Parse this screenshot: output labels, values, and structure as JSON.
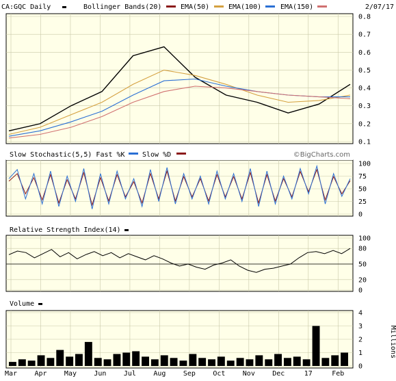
{
  "header": {
    "symbol_label": "CA:GQC Daily",
    "date": "2/07/17",
    "legend": [
      {
        "label": "Bollinger Bands(20)",
        "color": "#8b1a1a"
      },
      {
        "label": "EMA(50)",
        "color": "#d4a040"
      },
      {
        "label": "EMA(100)",
        "color": "#2a6fd4"
      },
      {
        "label": "EMA(150)",
        "color": "#d07070"
      }
    ]
  },
  "watermark": "©BigCharts.com",
  "panels": {
    "stochastic": {
      "title": "Slow Stochastic(5,5) Fast %K",
      "legend": [
        {
          "label": "Slow %D",
          "color": "#8b1a1a"
        }
      ],
      "k_color": "#2a6fd4"
    },
    "rsi": {
      "title": "Relative Strength Index(14)"
    },
    "volume": {
      "title": "Volume",
      "units_label": "Millions"
    }
  },
  "axes": {
    "price_ticks": [
      "0.8",
      "0.7",
      "0.6",
      "0.5",
      "0.4",
      "0.3",
      "0.2",
      "0.1"
    ],
    "stoch_ticks": [
      "100",
      "75",
      "50",
      "25",
      "0"
    ],
    "rsi_ticks": [
      "100",
      "80",
      "50",
      "20",
      "0"
    ],
    "volume_ticks": [
      "4",
      "3",
      "2",
      "1",
      "0"
    ],
    "months": [
      "Mar",
      "Apr",
      "May",
      "Jun",
      "Jul",
      "Aug",
      "Sep",
      "Oct",
      "Nov",
      "Dec",
      "17",
      "Feb"
    ]
  },
  "chart_data": [
    {
      "type": "line",
      "panel": "price",
      "ylim": [
        0.1,
        0.8
      ],
      "x": [
        "Mar",
        "Apr",
        "May",
        "Jun",
        "Jul",
        "Aug",
        "Sep",
        "Oct",
        "Nov",
        "Dec",
        "17",
        "Feb"
      ],
      "series": [
        {
          "name": "CA:GQC Daily",
          "values": [
            0.16,
            0.2,
            0.3,
            0.38,
            0.58,
            0.63,
            0.46,
            0.36,
            0.32,
            0.26,
            0.31,
            0.42
          ]
        },
        {
          "name": "EMA(50)",
          "values": [
            0.14,
            0.18,
            0.25,
            0.32,
            0.42,
            0.5,
            0.47,
            0.42,
            0.36,
            0.32,
            0.33,
            0.36
          ]
        },
        {
          "name": "EMA(100)",
          "values": [
            0.13,
            0.16,
            0.21,
            0.27,
            0.36,
            0.44,
            0.45,
            0.41,
            0.38,
            0.36,
            0.35,
            0.35
          ]
        },
        {
          "name": "EMA(150)",
          "values": [
            0.12,
            0.14,
            0.18,
            0.24,
            0.32,
            0.38,
            0.41,
            0.4,
            0.38,
            0.36,
            0.35,
            0.34
          ]
        }
      ]
    },
    {
      "type": "line",
      "panel": "stochastic",
      "ylim": [
        0,
        100
      ],
      "series": [
        {
          "name": "Fast %K",
          "values": [
            70,
            88,
            30,
            80,
            20,
            85,
            15,
            75,
            25,
            90,
            10,
            80,
            20,
            85,
            30,
            70,
            15,
            88,
            25,
            92,
            20,
            80,
            30,
            75,
            20,
            85,
            30,
            80,
            25,
            90,
            15,
            85,
            20,
            75,
            30,
            90,
            40,
            95,
            20,
            80,
            35,
            70
          ]
        },
        {
          "name": "Slow %D",
          "values": [
            65,
            80,
            40,
            72,
            28,
            78,
            22,
            68,
            30,
            82,
            18,
            72,
            26,
            78,
            34,
            64,
            22,
            80,
            30,
            85,
            26,
            74,
            34,
            70,
            26,
            78,
            34,
            74,
            30,
            82,
            22,
            78,
            26,
            70,
            34,
            84,
            44,
            88,
            28,
            74,
            40,
            66
          ]
        }
      ]
    },
    {
      "type": "line",
      "panel": "rsi",
      "ylim": [
        0,
        100
      ],
      "series": [
        {
          "name": "RSI(14)",
          "values": [
            68,
            75,
            72,
            62,
            70,
            78,
            64,
            72,
            60,
            68,
            74,
            66,
            72,
            62,
            70,
            64,
            58,
            66,
            60,
            52,
            46,
            50,
            44,
            40,
            48,
            52,
            58,
            46,
            38,
            34,
            40,
            42,
            46,
            50,
            62,
            72,
            74,
            70,
            76,
            70,
            80
          ]
        }
      ]
    },
    {
      "type": "bar",
      "panel": "volume",
      "ylim": [
        0,
        4
      ],
      "series": [
        {
          "name": "Volume",
          "values": [
            0.3,
            0.5,
            0.4,
            0.8,
            0.6,
            1.2,
            0.7,
            0.9,
            1.8,
            0.6,
            0.5,
            0.9,
            1.0,
            1.1,
            0.7,
            0.5,
            0.8,
            0.6,
            0.4,
            0.9,
            0.6,
            0.5,
            0.7,
            0.4,
            0.6,
            0.5,
            0.8,
            0.5,
            0.9,
            0.6,
            0.7,
            0.5,
            3.0,
            0.6,
            0.8,
            1.0
          ]
        }
      ]
    }
  ]
}
